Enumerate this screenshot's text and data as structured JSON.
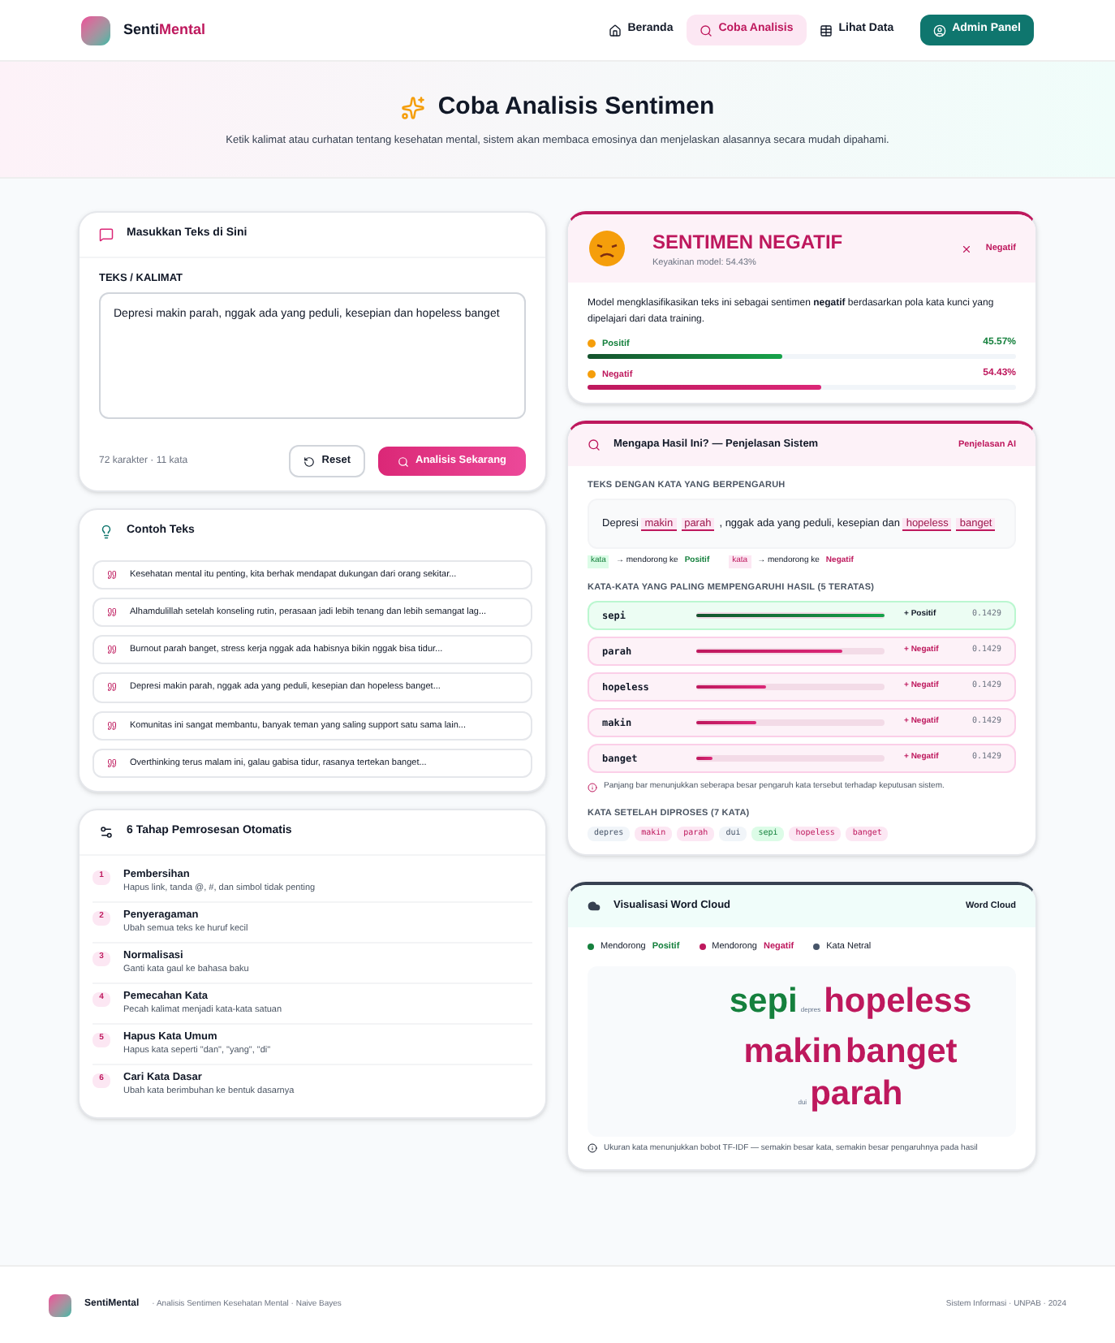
{
  "brand": {
    "prefix": "Senti",
    "accent": "Mental"
  },
  "nav": [
    {
      "label": "Beranda",
      "kind": "link",
      "selected": false
    },
    {
      "label": "Coba Analisis",
      "kind": "link",
      "selected": true
    },
    {
      "label": "Lihat Data",
      "kind": "link",
      "selected": false
    },
    {
      "label": "Admin Panel",
      "kind": "cta",
      "selected": false
    }
  ],
  "hero": {
    "title": "Coba Analisis Sentimen",
    "subtitle": "Ketik kalimat atau curhatan tentang kesehatan mental, sistem akan membaca emosinya dan menjelaskan alasannya secara mudah dipahami."
  },
  "input_card": {
    "title": "Masukkan Teks di Sini",
    "label": "TEKS / KALIMAT",
    "value": "Depresi makin parah, nggak ada yang peduli, kesepian dan hopeless banget",
    "counter": "72 karakter · 11 kata",
    "reset": "Reset",
    "submit": "Analisis Sekarang"
  },
  "examples": {
    "title": "Contoh Teks",
    "items": [
      "Kesehatan mental itu penting, kita berhak mendapat dukungan dari orang sekitar...",
      "Alhamdulillah setelah konseling rutin, perasaan jadi lebih tenang dan lebih semangat lag...",
      "Burnout parah banget, stress kerja nggak ada habisnya bikin nggak bisa tidur...",
      "Depresi makin parah, nggak ada yang peduli, kesepian dan hopeless banget...",
      "Komunitas ini sangat membantu, banyak teman yang saling support satu sama lain...",
      "Overthinking terus malam ini, galau gabisa tidur, rasanya tertekan banget..."
    ]
  },
  "steps": {
    "title": "6 Tahap Pemrosesan Otomatis",
    "items": [
      {
        "number": "1",
        "name": "Pembersihan",
        "desc": "Hapus link, tanda @, #, dan simbol tidak penting"
      },
      {
        "number": "2",
        "name": "Penyeragaman",
        "desc": "Ubah semua teks ke huruf kecil"
      },
      {
        "number": "3",
        "name": "Normalisasi",
        "desc": "Ganti kata gaul ke bahasa baku"
      },
      {
        "number": "4",
        "name": "Pemecahan Kata",
        "desc": "Pecah kalimat menjadi kata-kata satuan"
      },
      {
        "number": "5",
        "name": "Hapus Kata Umum",
        "desc": "Hapus kata seperti \"dan\", \"yang\", \"di\""
      },
      {
        "number": "6",
        "name": "Cari Kata Dasar",
        "desc": "Ubah kata berimbuhan ke bentuk dasarnya"
      }
    ]
  },
  "result": {
    "title": "SENTIMEN NEGATIF",
    "confidence": "Keyakinan model: 54.43%",
    "badge": "Negatif",
    "summary": "Model mengklasifikasikan teks ini sebagai sentimen **negatif** berdasarkan pola kata kunci yang dipelajari dari data training.",
    "bars": [
      {
        "label": "Positif",
        "kind": "positive",
        "reading": "45.57%",
        "level": 0.4557
      },
      {
        "label": "Negatif",
        "kind": "negative",
        "reading": "54.43%",
        "level": 0.5443
      }
    ]
  },
  "explanation": {
    "title": "Mengapa Hasil Ini? — Penjelasan Sistem",
    "badge": "Penjelasan AI",
    "highlight_label": "TEKS DENGAN KATA YANG BERPENGARUH",
    "segments": [
      {
        "text": "Depresi ",
        "kind": "plain"
      },
      {
        "text": "makin",
        "kind": "negative"
      },
      {
        "text": "parah",
        "kind": "negative"
      },
      {
        "text": ", nggak ada yang peduli, kesepian dan ",
        "kind": "plain"
      },
      {
        "text": "hopeless",
        "kind": "negative"
      },
      {
        "text": "banget",
        "kind": "negative"
      }
    ],
    "legend": [
      {
        "sample": "kata",
        "text": "→ mendorong ke",
        "tone": "Positif",
        "kind": "positive"
      },
      {
        "sample": "kata",
        "text": "→ mendorong ke",
        "tone": "Negatif",
        "kind": "negative"
      }
    ],
    "top_label": "KATA-KATA YANG PALING MEMPENGARUHI HASIL (5 TERATAS)",
    "top_words": [
      {
        "word": "sepi",
        "kind": "positive",
        "tag": "+ Positif",
        "reading": "0.1429",
        "level": 1.0
      },
      {
        "word": "parah",
        "kind": "negative",
        "tag": "+ Negatif",
        "reading": "0.1429",
        "level": 0.78
      },
      {
        "word": "hopeless",
        "kind": "negative",
        "tag": "+ Negatif",
        "reading": "0.1429",
        "level": 0.37
      },
      {
        "word": "makin",
        "kind": "negative",
        "tag": "+ Negatif",
        "reading": "0.1429",
        "level": 0.32
      },
      {
        "word": "banget",
        "kind": "negative",
        "tag": "+ Negatif",
        "reading": "0.1429",
        "level": 0.09
      }
    ],
    "note": "Panjang bar menunjukkan seberapa besar pengaruh kata tersebut terhadap keputusan sistem.",
    "tokens_label": "KATA SETELAH DIPROSES (7 KATA)",
    "tokens": [
      {
        "text": "depres",
        "kind": "neutral"
      },
      {
        "text": "makin",
        "kind": "negative"
      },
      {
        "text": "parah",
        "kind": "negative"
      },
      {
        "text": "dui",
        "kind": "neutral"
      },
      {
        "text": "sepi",
        "kind": "positive"
      },
      {
        "text": "hopeless",
        "kind": "negative"
      },
      {
        "text": "banget",
        "kind": "negative"
      }
    ]
  },
  "wordcloud": {
    "title": "Visualisasi Word Cloud",
    "badge": "Word Cloud",
    "legend": [
      {
        "prefix": "Mendorong",
        "tone": "Positif",
        "kind": "positive"
      },
      {
        "prefix": "Mendorong",
        "tone": "Negatif",
        "kind": "negative"
      },
      {
        "prefix": "Kata Netral",
        "kind": "neutral"
      }
    ],
    "rows": [
      [
        {
          "text": "sepi",
          "kind": "positive"
        },
        {
          "text": "depres",
          "kind": "neutral"
        },
        {
          "text": "hopeless",
          "kind": "negative"
        }
      ],
      [
        {
          "text": "makin",
          "kind": "negative"
        },
        {
          "text": "banget",
          "kind": "negative"
        }
      ],
      [
        {
          "text": "dui",
          "kind": "neutral"
        },
        {
          "text": "parah",
          "kind": "negative"
        }
      ]
    ],
    "note": "Ukuran kata menunjukkan bobot TF-IDF — semakin besar kata, semakin besar pengaruhnya pada hasil"
  },
  "footer": {
    "brand": "SentiMental",
    "tagline": "· Analisis Sentimen Kesehatan Mental · Naive Bayes",
    "right": "Sistem Informasi · UNPAB · 2024"
  }
}
